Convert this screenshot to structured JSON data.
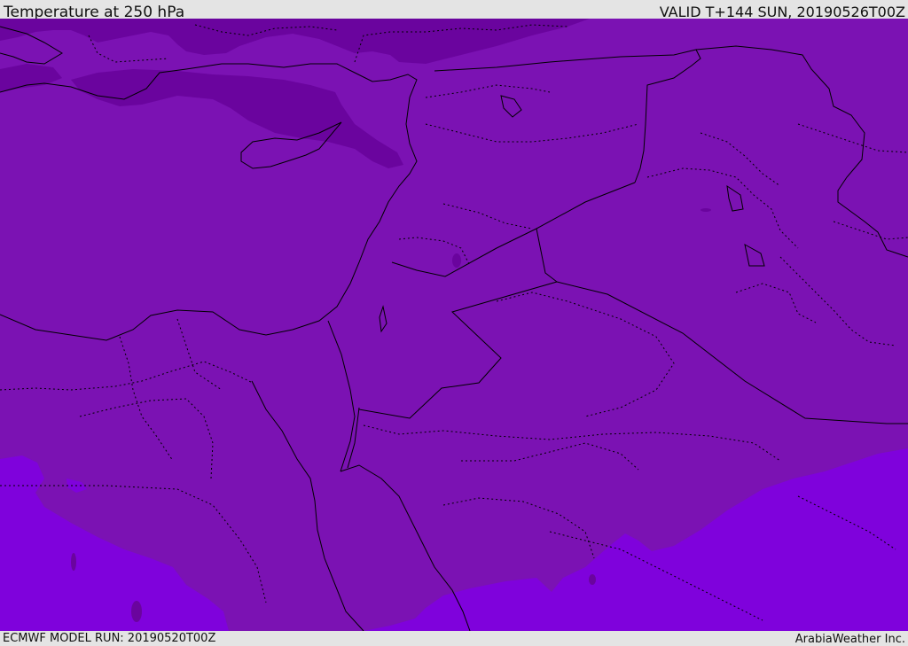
{
  "header": {
    "title": "Temperature at 250 hPa",
    "valid": "VALID T+144 SUN, 20190526T00Z"
  },
  "footer": {
    "model_run": "ECMWF MODEL RUN: 20190520T00Z",
    "credit": "ArabiaWeather Inc."
  },
  "map": {
    "region": "Eastern Mediterranean and Middle East",
    "colors": {
      "band_mid": "#7b12b3",
      "band_cold": "#6a049e",
      "band_warm": "#7f02dc",
      "coast_line": "#000000",
      "border_line": "#000000"
    },
    "styles": {
      "coastlines": "solid",
      "national_borders": "solid",
      "province_borders": "dotted"
    }
  }
}
